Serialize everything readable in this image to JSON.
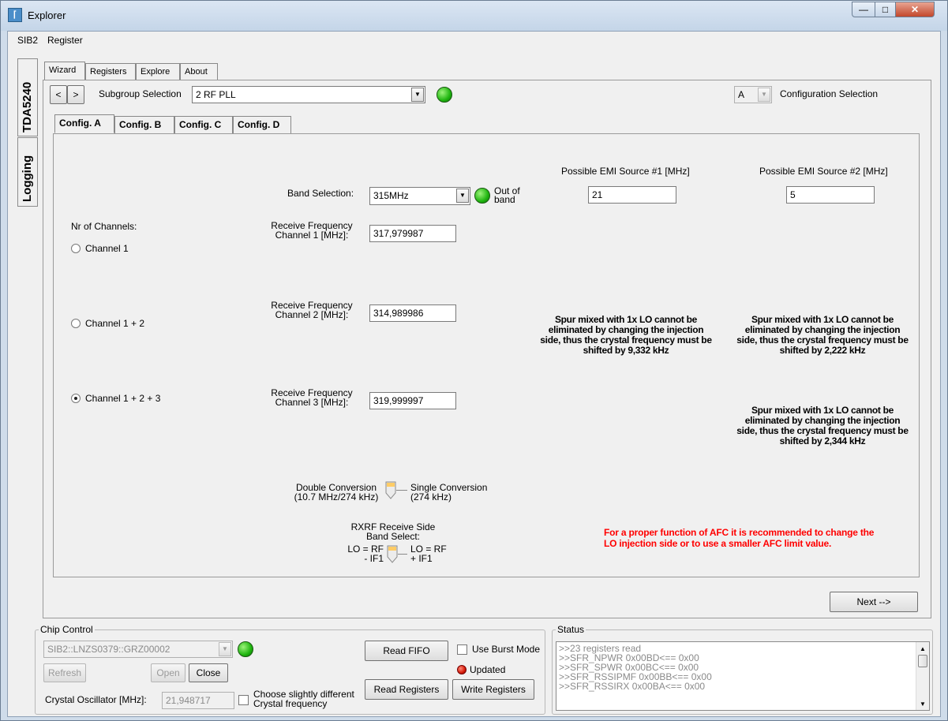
{
  "window": {
    "title": "Explorer",
    "app_icon": "antenna-icon"
  },
  "menu": {
    "items": [
      "SIB2",
      "Register"
    ]
  },
  "side_tabs": {
    "device": "TDA5240",
    "logging": "Logging"
  },
  "main_tabs": [
    "Wizard",
    "Registers",
    "Explore",
    "About"
  ],
  "nav": {
    "prev": "<",
    "next": ">",
    "subgroup_label": "Subgroup Selection",
    "subgroup_value": "2 RF PLL",
    "config_value": "A",
    "config_label": "Configuration Selection"
  },
  "config_tabs": [
    "Config. A",
    "Config. B",
    "Config. C",
    "Config. D"
  ],
  "config": {
    "band_label": "Band Selection:",
    "band_value": "315MHz",
    "band_status": "Out of band",
    "emi1_label": "Possible EMI Source #1 [MHz]",
    "emi1_value": "21",
    "emi2_label": "Possible EMI Source #2 [MHz]",
    "emi2_value": "5",
    "nr_channels_label": "Nr of Channels:",
    "channels": [
      {
        "label": "Channel 1",
        "selected": false
      },
      {
        "label": "Channel 1 + 2",
        "selected": false
      },
      {
        "label": "Channel 1 + 2 + 3",
        "selected": true
      }
    ],
    "freq1_label_1": "Receive Frequency",
    "freq1_label_2": "Channel 1 [MHz]:",
    "freq1_value": "317,979987",
    "freq2_label_1": "Receive Frequency",
    "freq2_label_2": "Channel 2 [MHz]:",
    "freq2_value": "314,989986",
    "freq3_label_1": "Receive Frequency",
    "freq3_label_2": "Channel 3 [MHz]:",
    "freq3_value": "319,999997",
    "spur_ch2_emi1": [
      "Spur mixed with 1x LO cannot be",
      "eliminated by changing the injection",
      "side, thus the crystal frequency must be",
      "shifted by 9,332 kHz"
    ],
    "spur_ch2_emi2": [
      "Spur mixed with 1x LO cannot be",
      "eliminated by changing the injection",
      "side, thus the crystal frequency must be",
      "shifted by 2,222 kHz"
    ],
    "spur_ch3_emi2": [
      "Spur mixed with 1x LO cannot be",
      "eliminated by changing the injection",
      "side, thus the crystal frequency must be",
      "shifted by 2,344 kHz"
    ],
    "double_conv_1": "Double Conversion",
    "double_conv_2": "(10.7 MHz/274 kHz)",
    "single_conv_1": "Single Conversion",
    "single_conv_2": "(274 kHz)",
    "rxrf_label_1": "RXRF Receive Side",
    "rxrf_label_2": "Band Select:",
    "lo_minus_1": "LO = RF",
    "lo_minus_2": "- IF1",
    "lo_plus_1": "LO = RF",
    "lo_plus_2": "+ IF1",
    "afc_warning_1": "For a proper function of AFC it is recommended to change the",
    "afc_warning_2": "LO injection side or to use a smaller AFC limit value.",
    "next_button": "Next -->"
  },
  "chip_control": {
    "title": "Chip Control",
    "device_value": "SIB2::LNZS0379::GRZ00002",
    "refresh": "Refresh",
    "open": "Open",
    "close": "Close",
    "crystal_label": "Crystal Oscillator [MHz]:",
    "crystal_value": "21,948717",
    "choose_crystal_1": "Choose slightly different",
    "choose_crystal_2": "Crystal frequency",
    "read_fifo": "Read FIFO",
    "use_burst": "Use Burst Mode",
    "updated": "Updated",
    "read_registers": "Read Registers",
    "write_registers": "Write Registers"
  },
  "status": {
    "title": "Status",
    "lines": [
      ">>23 registers read",
      ">>SFR_NPWR 0x00BD<== 0x00",
      ">>SFR_SPWR 0x00BC<== 0x00",
      ">>SFR_RSSIPMF 0x00BB<== 0x00",
      ">>SFR_RSSIRX 0x00BA<== 0x00"
    ]
  },
  "colors": {
    "warning": "#ff0000",
    "led_green": "#1fb50f",
    "led_red": "#d51a08",
    "title_bar": "#c4d5e8"
  }
}
